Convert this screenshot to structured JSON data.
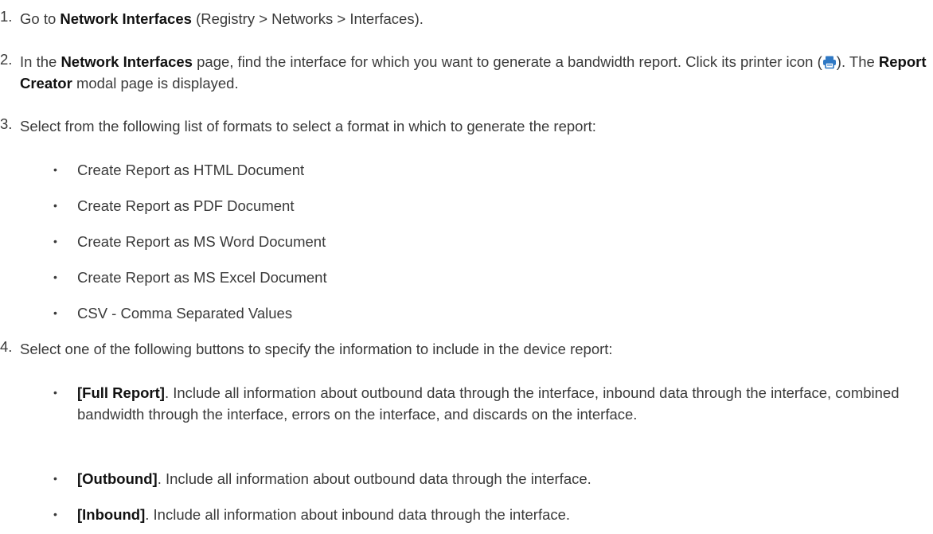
{
  "steps": [
    {
      "num": "1.",
      "pre": "Go to ",
      "bold": "Network Interfaces",
      "post": " (Registry > Networks > Interfaces)."
    },
    {
      "num": "2.",
      "pre": "In the ",
      "bold": "Network Interfaces",
      "mid": " page, find the interface for which you want to generate a bandwidth report. Click its printer icon (",
      "icon": "printer-icon",
      "mid2": "). The ",
      "bold2": "Report Creator",
      "post": " modal page is displayed."
    },
    {
      "num": "3.",
      "text": "Select from the following list of formats to select a format in which to generate the report:",
      "formats": [
        "Create Report as HTML Document",
        "Create Report as PDF Document",
        "Create Report as MS Word Document",
        "Create Report as MS Excel Document",
        "CSV - Comma Separated Values"
      ]
    },
    {
      "num": "4.",
      "text": "Select one of the following buttons to specify the information to include in the device report:",
      "options": [
        {
          "label": "[Full Report]",
          "desc": ". Include all information about outbound data through the interface, inbound data through the interface, combined bandwidth through the interface, errors on the interface, and discards on the interface."
        },
        {
          "label": "[Outbound]",
          "desc": ". Include all information about outbound data through the interface."
        },
        {
          "label": "[Inbound]",
          "desc": ". Include all information about inbound data through the interface."
        }
      ]
    }
  ],
  "bullet_char": "•",
  "colors": {
    "text": "#3a3a3a",
    "bold": "#111111",
    "icon": "#2f78c4"
  }
}
